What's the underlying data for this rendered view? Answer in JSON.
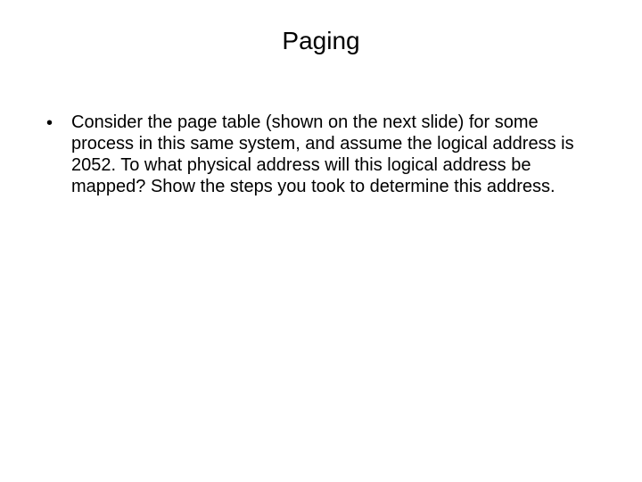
{
  "slide": {
    "title": "Paging",
    "bullets": [
      {
        "marker": "•",
        "text": "Consider the page table (shown on the next slide) for some process in this same system, and assume the logical address is 2052. To what physical address will this logical address be mapped? Show the steps you took to determine this address."
      }
    ]
  }
}
